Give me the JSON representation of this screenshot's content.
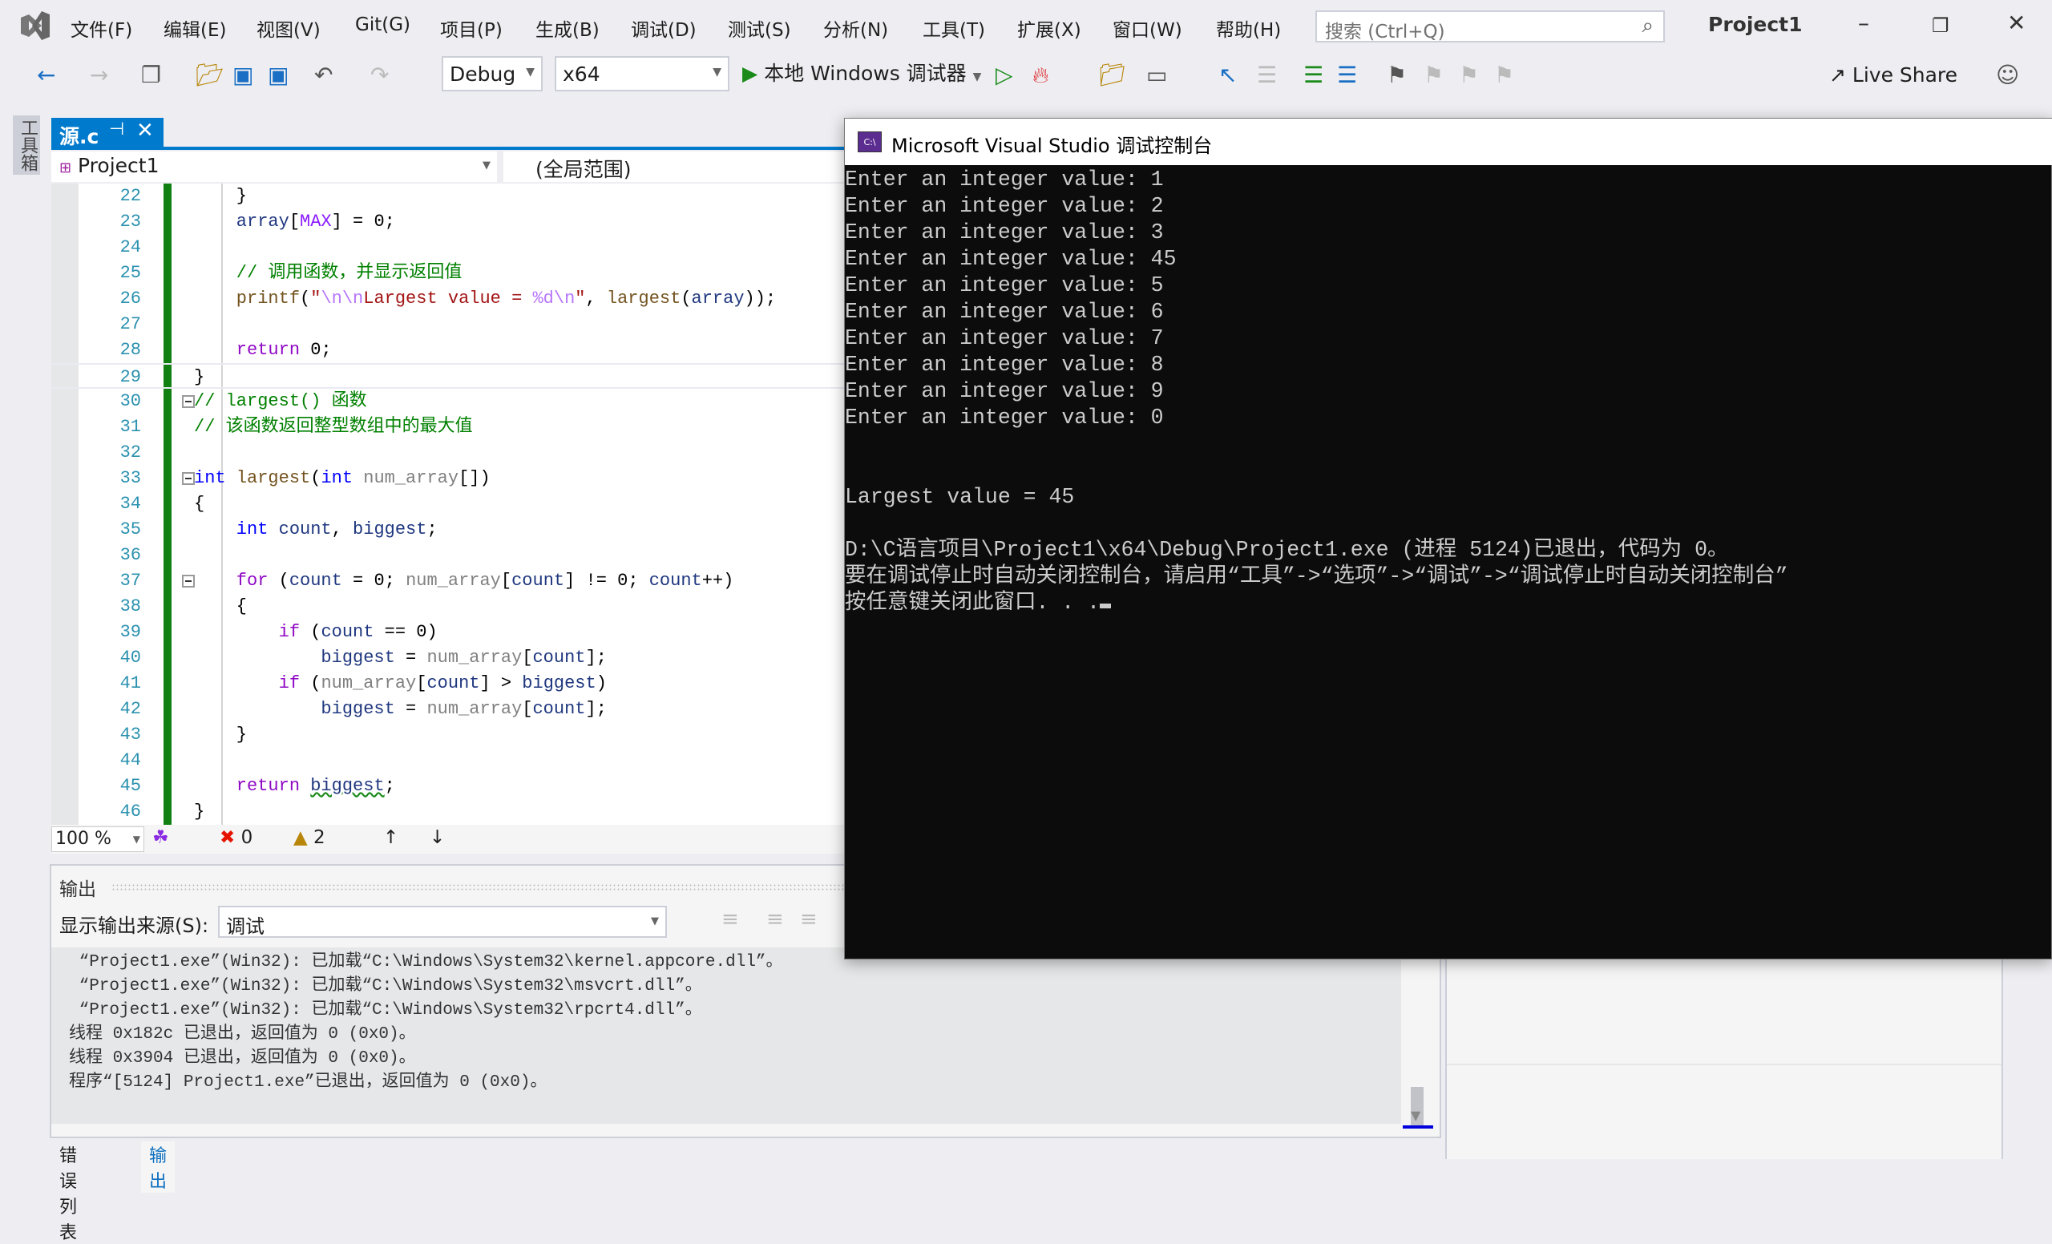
{
  "menubar": {
    "items": [
      "文件(F)",
      "编辑(E)",
      "视图(V)",
      "Git(G)",
      "项目(P)",
      "生成(B)",
      "调试(D)",
      "测试(S)",
      "分析(N)",
      "工具(T)",
      "扩展(X)",
      "窗口(W)",
      "帮助(H)"
    ],
    "search_placeholder": "搜索 (Ctrl+Q)",
    "project_title": "Project1"
  },
  "toolbar": {
    "config": "Debug",
    "platform": "x64",
    "run_label": "本地 Windows 调试器",
    "live_share": "Live Share"
  },
  "toolbox_label": "工具箱",
  "doc_tab": {
    "name": "源.c"
  },
  "navbar": {
    "project": "Project1",
    "scope": "(全局范围)"
  },
  "editor": {
    "lines": [
      {
        "n": "22",
        "t": [
          [
            "    }",
            "pl"
          ]
        ]
      },
      {
        "n": "23",
        "t": [
          [
            "    array",
            "loc"
          ],
          [
            "[",
            "pl"
          ],
          [
            "MAX",
            "mac"
          ],
          [
            "] = 0;",
            "pl"
          ]
        ]
      },
      {
        "n": "24",
        "t": []
      },
      {
        "n": "25",
        "t": [
          [
            "    // 调用函数，并显示返回值",
            "cm"
          ]
        ]
      },
      {
        "n": "26",
        "t": [
          [
            "    printf",
            "fn"
          ],
          [
            "(",
            "pl"
          ],
          [
            "\"",
            "str"
          ],
          [
            "\\n\\n",
            "esc"
          ],
          [
            "Largest value = ",
            "str"
          ],
          [
            "%d",
            "esc"
          ],
          [
            "\\n",
            "esc"
          ],
          [
            "\"",
            "str"
          ],
          [
            ", ",
            "pl"
          ],
          [
            "largest",
            "fn"
          ],
          [
            "(",
            "pl"
          ],
          [
            "array",
            "loc"
          ],
          [
            "));",
            "pl"
          ]
        ]
      },
      {
        "n": "27",
        "t": []
      },
      {
        "n": "28",
        "t": [
          [
            "    return",
            "ctl"
          ],
          [
            " 0;",
            "pl"
          ]
        ]
      },
      {
        "n": "29",
        "t": [
          [
            "}",
            "pl"
          ]
        ],
        "cur": true
      },
      {
        "n": "30",
        "t": [
          [
            "// largest() 函数",
            "cm"
          ]
        ],
        "fold": true
      },
      {
        "n": "31",
        "t": [
          [
            "// 该函数返回整型数组中的最大值",
            "cm"
          ]
        ]
      },
      {
        "n": "32",
        "t": []
      },
      {
        "n": "33",
        "t": [
          [
            "int",
            "kw"
          ],
          [
            " ",
            "pl"
          ],
          [
            "largest",
            "fn"
          ],
          [
            "(",
            "pl"
          ],
          [
            "int",
            "kw"
          ],
          [
            " ",
            "pl"
          ],
          [
            "num_array",
            "par"
          ],
          [
            "[])",
            "pl"
          ]
        ],
        "fold": true
      },
      {
        "n": "34",
        "t": [
          [
            "{",
            "pl"
          ]
        ]
      },
      {
        "n": "35",
        "t": [
          [
            "    int",
            "kw"
          ],
          [
            " ",
            "pl"
          ],
          [
            "count",
            "loc"
          ],
          [
            ", ",
            "pl"
          ],
          [
            "biggest",
            "loc"
          ],
          [
            ";",
            "pl"
          ]
        ]
      },
      {
        "n": "36",
        "t": []
      },
      {
        "n": "37",
        "t": [
          [
            "    for",
            "ctl"
          ],
          [
            " (",
            "pl"
          ],
          [
            "count",
            "loc"
          ],
          [
            " = 0; ",
            "pl"
          ],
          [
            "num_array",
            "par"
          ],
          [
            "[",
            "pl"
          ],
          [
            "count",
            "loc"
          ],
          [
            "] != 0; ",
            "pl"
          ],
          [
            "count",
            "loc"
          ],
          [
            "++)",
            "pl"
          ]
        ],
        "fold": true
      },
      {
        "n": "38",
        "t": [
          [
            "    {",
            "pl"
          ]
        ]
      },
      {
        "n": "39",
        "t": [
          [
            "        if",
            "ctl"
          ],
          [
            " (",
            "pl"
          ],
          [
            "count",
            "loc"
          ],
          [
            " == 0)",
            "pl"
          ]
        ]
      },
      {
        "n": "40",
        "t": [
          [
            "            biggest",
            "loc"
          ],
          [
            " = ",
            "pl"
          ],
          [
            "num_array",
            "par"
          ],
          [
            "[",
            "pl"
          ],
          [
            "count",
            "loc"
          ],
          [
            "];",
            "pl"
          ]
        ]
      },
      {
        "n": "41",
        "t": [
          [
            "        if",
            "ctl"
          ],
          [
            " (",
            "pl"
          ],
          [
            "num_array",
            "par"
          ],
          [
            "[",
            "pl"
          ],
          [
            "count",
            "loc"
          ],
          [
            "] > ",
            "pl"
          ],
          [
            "biggest",
            "loc"
          ],
          [
            ")",
            "pl"
          ]
        ]
      },
      {
        "n": "42",
        "t": [
          [
            "            biggest",
            "loc"
          ],
          [
            " = ",
            "pl"
          ],
          [
            "num_array",
            "par"
          ],
          [
            "[",
            "pl"
          ],
          [
            "count",
            "loc"
          ],
          [
            "];",
            "pl"
          ]
        ]
      },
      {
        "n": "43",
        "t": [
          [
            "    }",
            "pl"
          ]
        ]
      },
      {
        "n": "44",
        "t": []
      },
      {
        "n": "45",
        "t": [
          [
            "    return",
            "ctl"
          ],
          [
            " ",
            "pl"
          ],
          [
            "biggest",
            "loc"
          ],
          [
            ";",
            "pl"
          ]
        ]
      },
      {
        "n": "46",
        "t": [
          [
            "}",
            "pl"
          ]
        ]
      }
    ]
  },
  "editor_status": {
    "zoom": "100 %",
    "errors": "0",
    "warnings": "2"
  },
  "output": {
    "title": "输出",
    "source_label": "显示输出来源(S):",
    "source_value": "调试",
    "lines": [
      " “Project1.exe”(Win32): 已加载“C:\\Windows\\System32\\kernel.appcore.dll”。",
      " “Project1.exe”(Win32): 已加载“C:\\Windows\\System32\\msvcrt.dll”。",
      " “Project1.exe”(Win32): 已加载“C:\\Windows\\System32\\rpcrt4.dll”。",
      "线程 0x182c 已退出，返回值为 0 (0x0)。",
      "线程 0x3904 已退出，返回值为 0 (0x0)。",
      "程序“[5124] Project1.exe”已退出，返回值为 0 (0x0)。"
    ]
  },
  "bottom_tabs": [
    "错误列表",
    "输出"
  ],
  "console": {
    "title": "Microsoft Visual Studio 调试控制台",
    "icon_text": "C:\\",
    "lines": [
      "Enter an integer value: 1",
      "Enter an integer value: 2",
      "Enter an integer value: 3",
      "Enter an integer value: 45",
      "Enter an integer value: 5",
      "Enter an integer value: 6",
      "Enter an integer value: 7",
      "Enter an integer value: 8",
      "Enter an integer value: 9",
      "Enter an integer value: 0",
      "",
      "",
      "Largest value = 45",
      "",
      "D:\\C语言项目\\Project1\\x64\\Debug\\Project1.exe (进程 5124)已退出，代码为 0。",
      "要在调试停止时自动关闭控制台，请启用“工具”->“选项”->“调试”->“调试停止时自动关闭控制台”",
      "按任意键关闭此窗口. . ."
    ]
  },
  "colors": {
    "accent": "#007acc",
    "console_bg": "#0c0c0c",
    "change_bar": "#108010"
  }
}
